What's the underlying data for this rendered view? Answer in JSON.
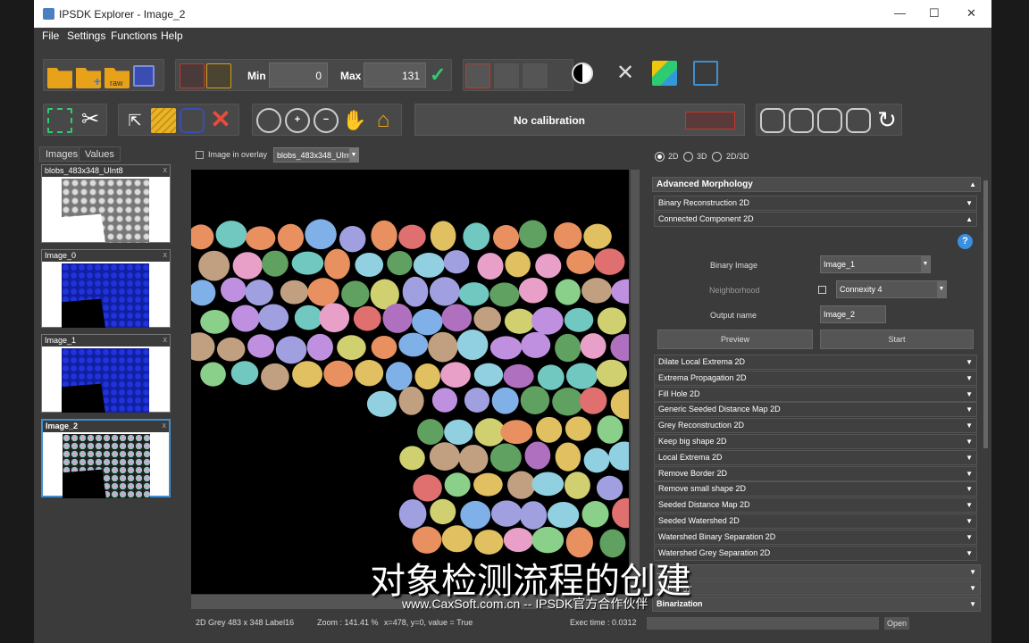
{
  "window": {
    "title": "IPSDK Explorer - Image_2",
    "minimize": "—",
    "maximize": "☐",
    "close": "✕"
  },
  "menu": [
    "File",
    "Settings",
    "Functions",
    "Help"
  ],
  "toolbar": {
    "min_label": "Min",
    "min_value": "0",
    "max_label": "Max",
    "max_value": "131",
    "raw_label": "raw"
  },
  "calibration": {
    "text": "No calibration"
  },
  "left_panel": {
    "tabs": [
      "Images",
      "Values"
    ],
    "images": [
      {
        "name": "blobs_483x348_UInt8",
        "close": "x"
      },
      {
        "name": "Image_0",
        "close": "x"
      },
      {
        "name": "Image_1",
        "close": "x"
      },
      {
        "name": "Image_2",
        "close": "x"
      }
    ]
  },
  "viewer": {
    "overlay_label": "Image in overlay",
    "overlay_select": "blobs_483x348_UInt"
  },
  "status": {
    "info": "2D Grey 483 x 348 Label16",
    "zoom": "Zoom : 141.41 %",
    "pixel": "x=478, y=0, value = True",
    "exec": "Exec time : 0.0312",
    "open": "Open"
  },
  "right_panel": {
    "dims": [
      "2D",
      "3D",
      "2D/3D"
    ],
    "section": "Advanced Morphology",
    "collapsed_top": [
      "Binary Reconstruction 2D"
    ],
    "expanded": "Connected Component 2D",
    "form": {
      "binary_image_label": "Binary Image",
      "binary_image_value": "Image_1",
      "neighborhood_label": "Neighborhood",
      "neighborhood_value": "Connexity 4",
      "output_label": "Output name",
      "output_value": "Image_2",
      "preview": "Preview",
      "start": "Start",
      "help": "?"
    },
    "items": [
      "Dilate Local Extrema 2D",
      "Extrema Propagation 2D",
      "Fill Hole 2D",
      "Generic Seeded Distance Map 2D",
      "Grey Reconstruction 2D",
      "Keep big shape 2D",
      "Local Extrema 2D",
      "Remove Border 2D",
      "Remove small shape 2D",
      "Seeded Distance Map 2D",
      "Seeded Watershed 2D",
      "Watershed Binary Separation 2D",
      "Watershed Grey Separation 2D"
    ],
    "bottom_sections": [
      "...c",
      "...phology",
      "Binarization"
    ]
  },
  "overlay_text": {
    "subtitle": "对象检测流程的创建",
    "watermark": "www.CaxSoft.com.cn -- IPSDK官方合作伙伴"
  },
  "arrow": "▼",
  "arrow_up": "▲",
  "colors": {
    "accent": "#3f8fd0",
    "folder": "#e8a21a",
    "check": "#2ecc71"
  }
}
